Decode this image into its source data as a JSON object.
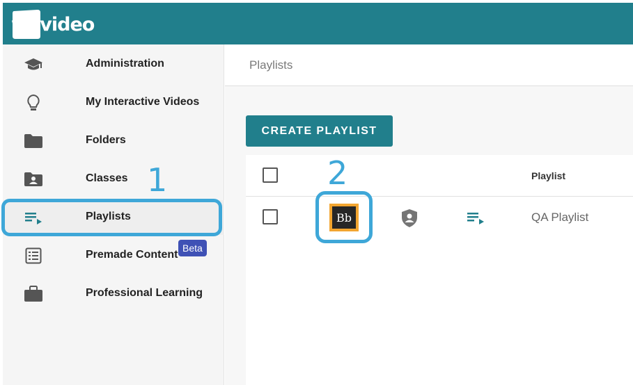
{
  "header": {
    "logo_text": "wevideo",
    "bg_color": "#217f8c"
  },
  "sidebar": {
    "items": [
      {
        "label": "Administration",
        "icon": "graduation-cap-icon"
      },
      {
        "label": "My Interactive Videos",
        "icon": "lightbulb-icon"
      },
      {
        "label": "Folders",
        "icon": "folder-icon"
      },
      {
        "label": "Classes",
        "icon": "class-folder-icon"
      },
      {
        "label": "Playlists",
        "icon": "playlist-icon",
        "active": true
      },
      {
        "label": "Premade Content",
        "icon": "list-icon",
        "badge": "Beta"
      },
      {
        "label": "Professional Learning",
        "icon": "briefcase-icon"
      }
    ]
  },
  "annotations": {
    "step1": "1",
    "step2": "2",
    "color": "#3ea7d8"
  },
  "main": {
    "page_title": "Playlists",
    "create_button": "CREATE PLAYLIST",
    "table": {
      "column_playlist": "Playlist",
      "rows": [
        {
          "name": "QA Playlist",
          "lms_icon": "blackboard-icon",
          "lms_text": "Bb",
          "access_icon": "shield-user-icon",
          "type_icon": "playlist-icon"
        }
      ]
    }
  }
}
